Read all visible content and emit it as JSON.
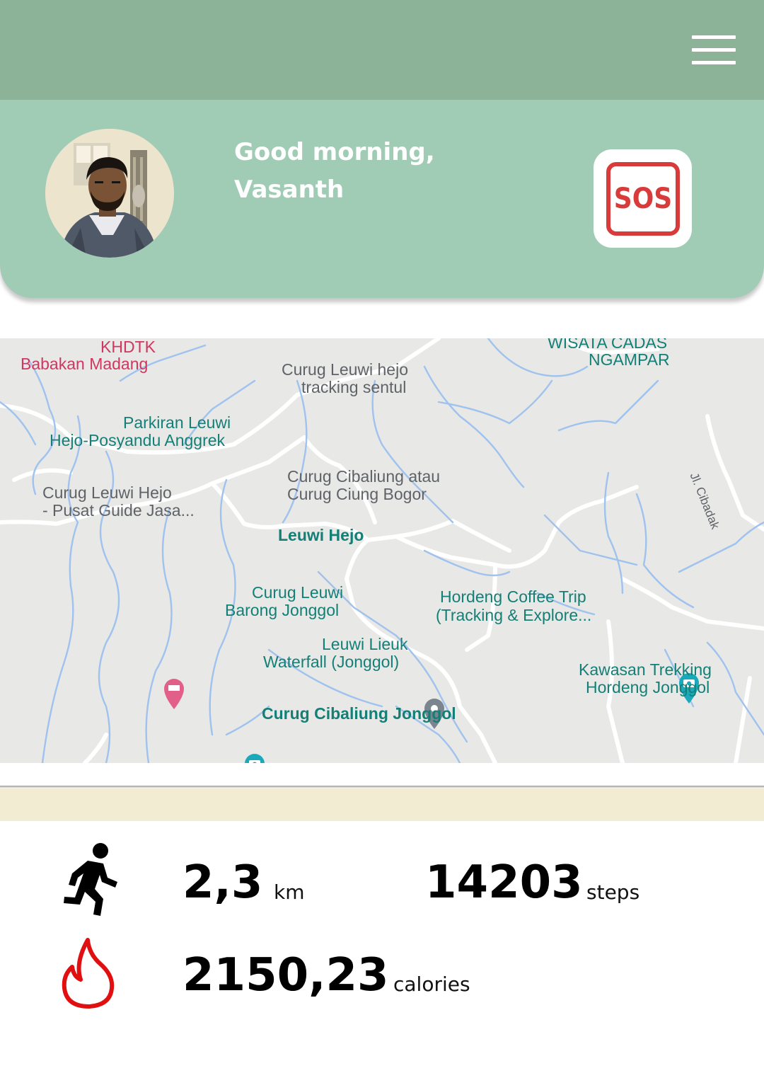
{
  "header": {
    "menu_icon": "hamburger-menu-icon",
    "background": "#8cb398"
  },
  "profile": {
    "greeting_line1": "Good morning,",
    "greeting_line2": "Vasanth",
    "avatar": "user-avatar-photo",
    "sos_label": "SOS",
    "card_color": "#a0cbb4",
    "sos_color": "#d93a3a"
  },
  "map": {
    "selected_place": "Leuwi Hejo",
    "labels": {
      "khdtk": "KHDTK",
      "babakan": "Babakan Madang",
      "wisata1": "WISATA CADAS",
      "wisata2": "NGAMPAR",
      "tracking1": "Curug Leuwi hejo",
      "tracking2": "tracking sentul",
      "parkiran1": "Parkiran Leuwi",
      "parkiran2": "Hejo-Posyandu Anggrek",
      "cibaliung1": "Curug Cibaliung atau",
      "cibaliung2": "Curug Ciung Bogor",
      "guide1": "Curug Leuwi Hejo",
      "guide2": "- Pusat Guide Jasa...",
      "road": "Jl. Cibadak",
      "barong1": "Curug Leuwi",
      "barong2": "Barong Jonggol",
      "hordeng1": "Hordeng Coffee Trip",
      "hordeng2": "(Tracking & Explore...",
      "lieuk1": "Leuwi Lieuk",
      "lieuk2": "Waterfall (Jonggol)",
      "trekking1": "Kawasan Trekking",
      "trekking2": "Hordeng Jonggol",
      "cibaliung_jonggol": "Curug Cibaliung Jonggol"
    }
  },
  "stats": {
    "distance_value": "2,3",
    "distance_unit": "km",
    "steps_value": "14203",
    "steps_unit": "steps",
    "calories_value": "2150,23",
    "calories_unit": "calories",
    "running_icon": "running-person-icon",
    "flame_icon": "flame-icon"
  }
}
